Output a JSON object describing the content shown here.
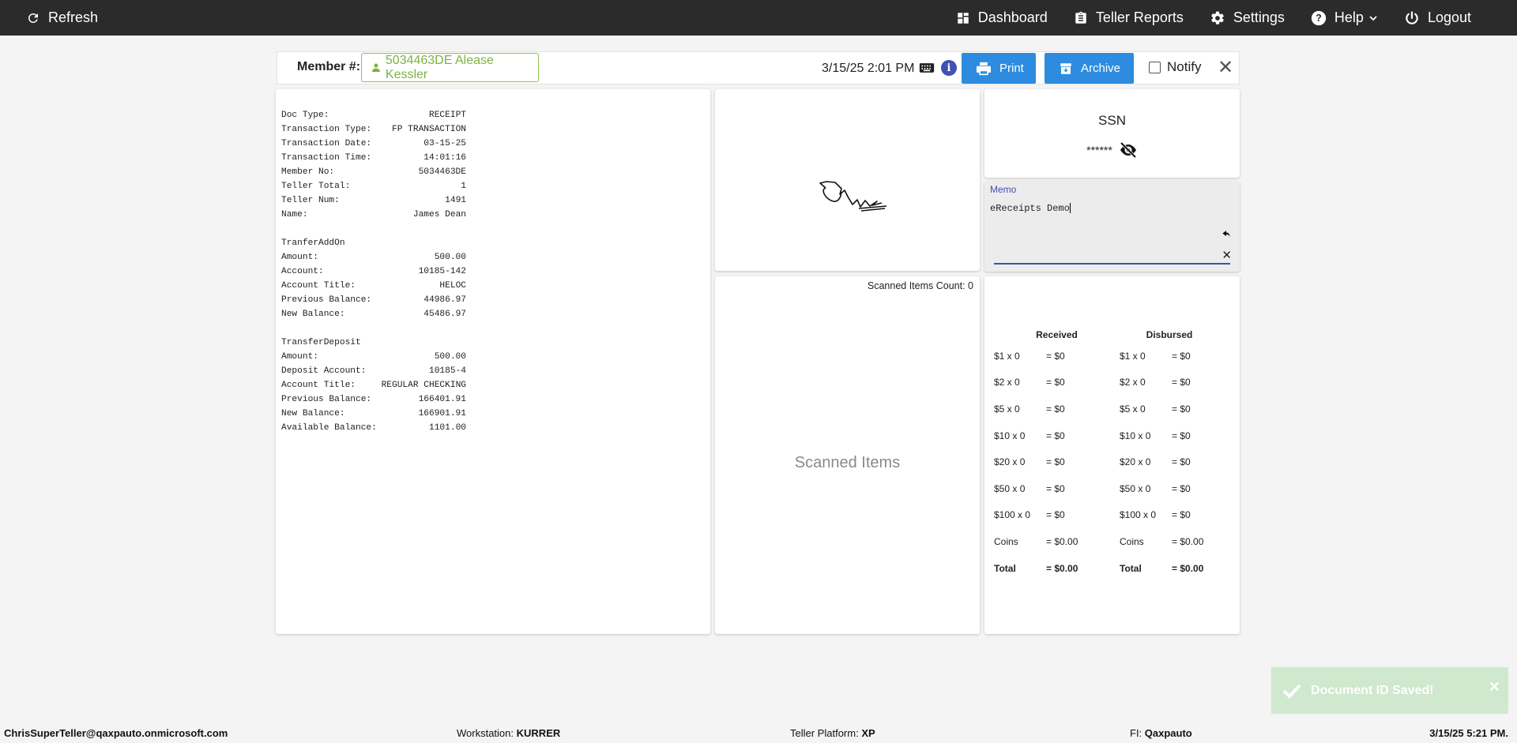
{
  "topbar": {
    "refresh_label": "Refresh",
    "dashboard_label": "Dashboard",
    "teller_reports_label": "Teller Reports",
    "settings_label": "Settings",
    "help_label": "Help",
    "logout_label": "Logout"
  },
  "member": {
    "label": "Member #:",
    "value": "5034463DE Alease Kessler",
    "datetime": "3/15/25 2:01 PM",
    "print_label": "Print",
    "archive_label": "Archive",
    "notify_label": "Notify",
    "close_symbol": "✕"
  },
  "receipt": {
    "lines": [
      [
        "Doc Type:",
        "RECEIPT"
      ],
      [
        "Transaction Type:",
        "FP TRANSACTION"
      ],
      [
        "Transaction Date:",
        "03-15-25"
      ],
      [
        "Transaction Time:",
        "14:01:16"
      ],
      [
        "Member No:",
        "5034463DE"
      ],
      [
        "Teller Total:",
        "1"
      ],
      [
        "Teller Num:",
        "1491"
      ],
      [
        "Name:",
        "James Dean"
      ],
      [
        "",
        ""
      ],
      [
        "TranferAddOn",
        ""
      ],
      [
        "Amount:",
        "500.00"
      ],
      [
        "Account:",
        "10185-142"
      ],
      [
        "Account Title:",
        "HELOC"
      ],
      [
        "Previous Balance:",
        "44986.97"
      ],
      [
        "New Balance:",
        "45486.97"
      ],
      [
        "",
        ""
      ],
      [
        "TransferDeposit",
        ""
      ],
      [
        "Amount:",
        "500.00"
      ],
      [
        "Deposit Account:",
        "10185-4"
      ],
      [
        "Account Title:",
        "REGULAR CHECKING"
      ],
      [
        "Previous Balance:",
        "166401.91"
      ],
      [
        "New Balance:",
        "166901.91"
      ],
      [
        "Available Balance:",
        "1101.00"
      ]
    ]
  },
  "ssn": {
    "title": "SSN",
    "masked": "******"
  },
  "memo": {
    "label": "Memo",
    "text": "eReceipts Demo"
  },
  "scanned": {
    "count_label": "Scanned Items Count: 0",
    "placeholder": "Scanned Items"
  },
  "cash": {
    "received_header": "Received",
    "disbursed_header": "Disbursed",
    "rows": [
      {
        "r_label": "$1 x 0",
        "r_val": "= $0",
        "d_label": "$1 x 0",
        "d_val": "= $0"
      },
      {
        "r_label": "$2 x 0",
        "r_val": "= $0",
        "d_label": "$2 x 0",
        "d_val": "= $0"
      },
      {
        "r_label": "$5 x 0",
        "r_val": "= $0",
        "d_label": "$5 x 0",
        "d_val": "= $0"
      },
      {
        "r_label": "$10 x 0",
        "r_val": "= $0",
        "d_label": "$10 x 0",
        "d_val": "= $0"
      },
      {
        "r_label": "$20 x 0",
        "r_val": "= $0",
        "d_label": "$20 x 0",
        "d_val": "= $0"
      },
      {
        "r_label": "$50 x 0",
        "r_val": "= $0",
        "d_label": "$50 x 0",
        "d_val": "= $0"
      },
      {
        "r_label": "$100 x 0",
        "r_val": "= $0",
        "d_label": "$100 x 0",
        "d_val": "= $0"
      },
      {
        "r_label": "Coins",
        "r_val": "= $0.00",
        "d_label": "Coins",
        "d_val": "= $0.00"
      },
      {
        "r_label": "Total",
        "r_val": "= $0.00",
        "d_label": "Total",
        "d_val": "= $0.00"
      }
    ]
  },
  "toast": {
    "message": "Document ID Saved!",
    "close_symbol": "✕"
  },
  "footer": {
    "user": "ChrisSuperTeller@qaxpauto.onmicrosoft.com",
    "workstation_label": "Workstation:",
    "workstation_value": "KURRER",
    "platform_label": "Teller Platform:",
    "platform_value": "XP",
    "fi_label": "FI:",
    "fi_value": "Qaxpauto",
    "datetime": "3/15/25 5:21 PM."
  },
  "colors": {
    "topbar_bg": "#2b2b2b",
    "accent_blue": "#2d8ce0",
    "member_green": "#7cb342",
    "memo_label": "#3f51b5",
    "toast_bg": "#cfe8cc"
  }
}
